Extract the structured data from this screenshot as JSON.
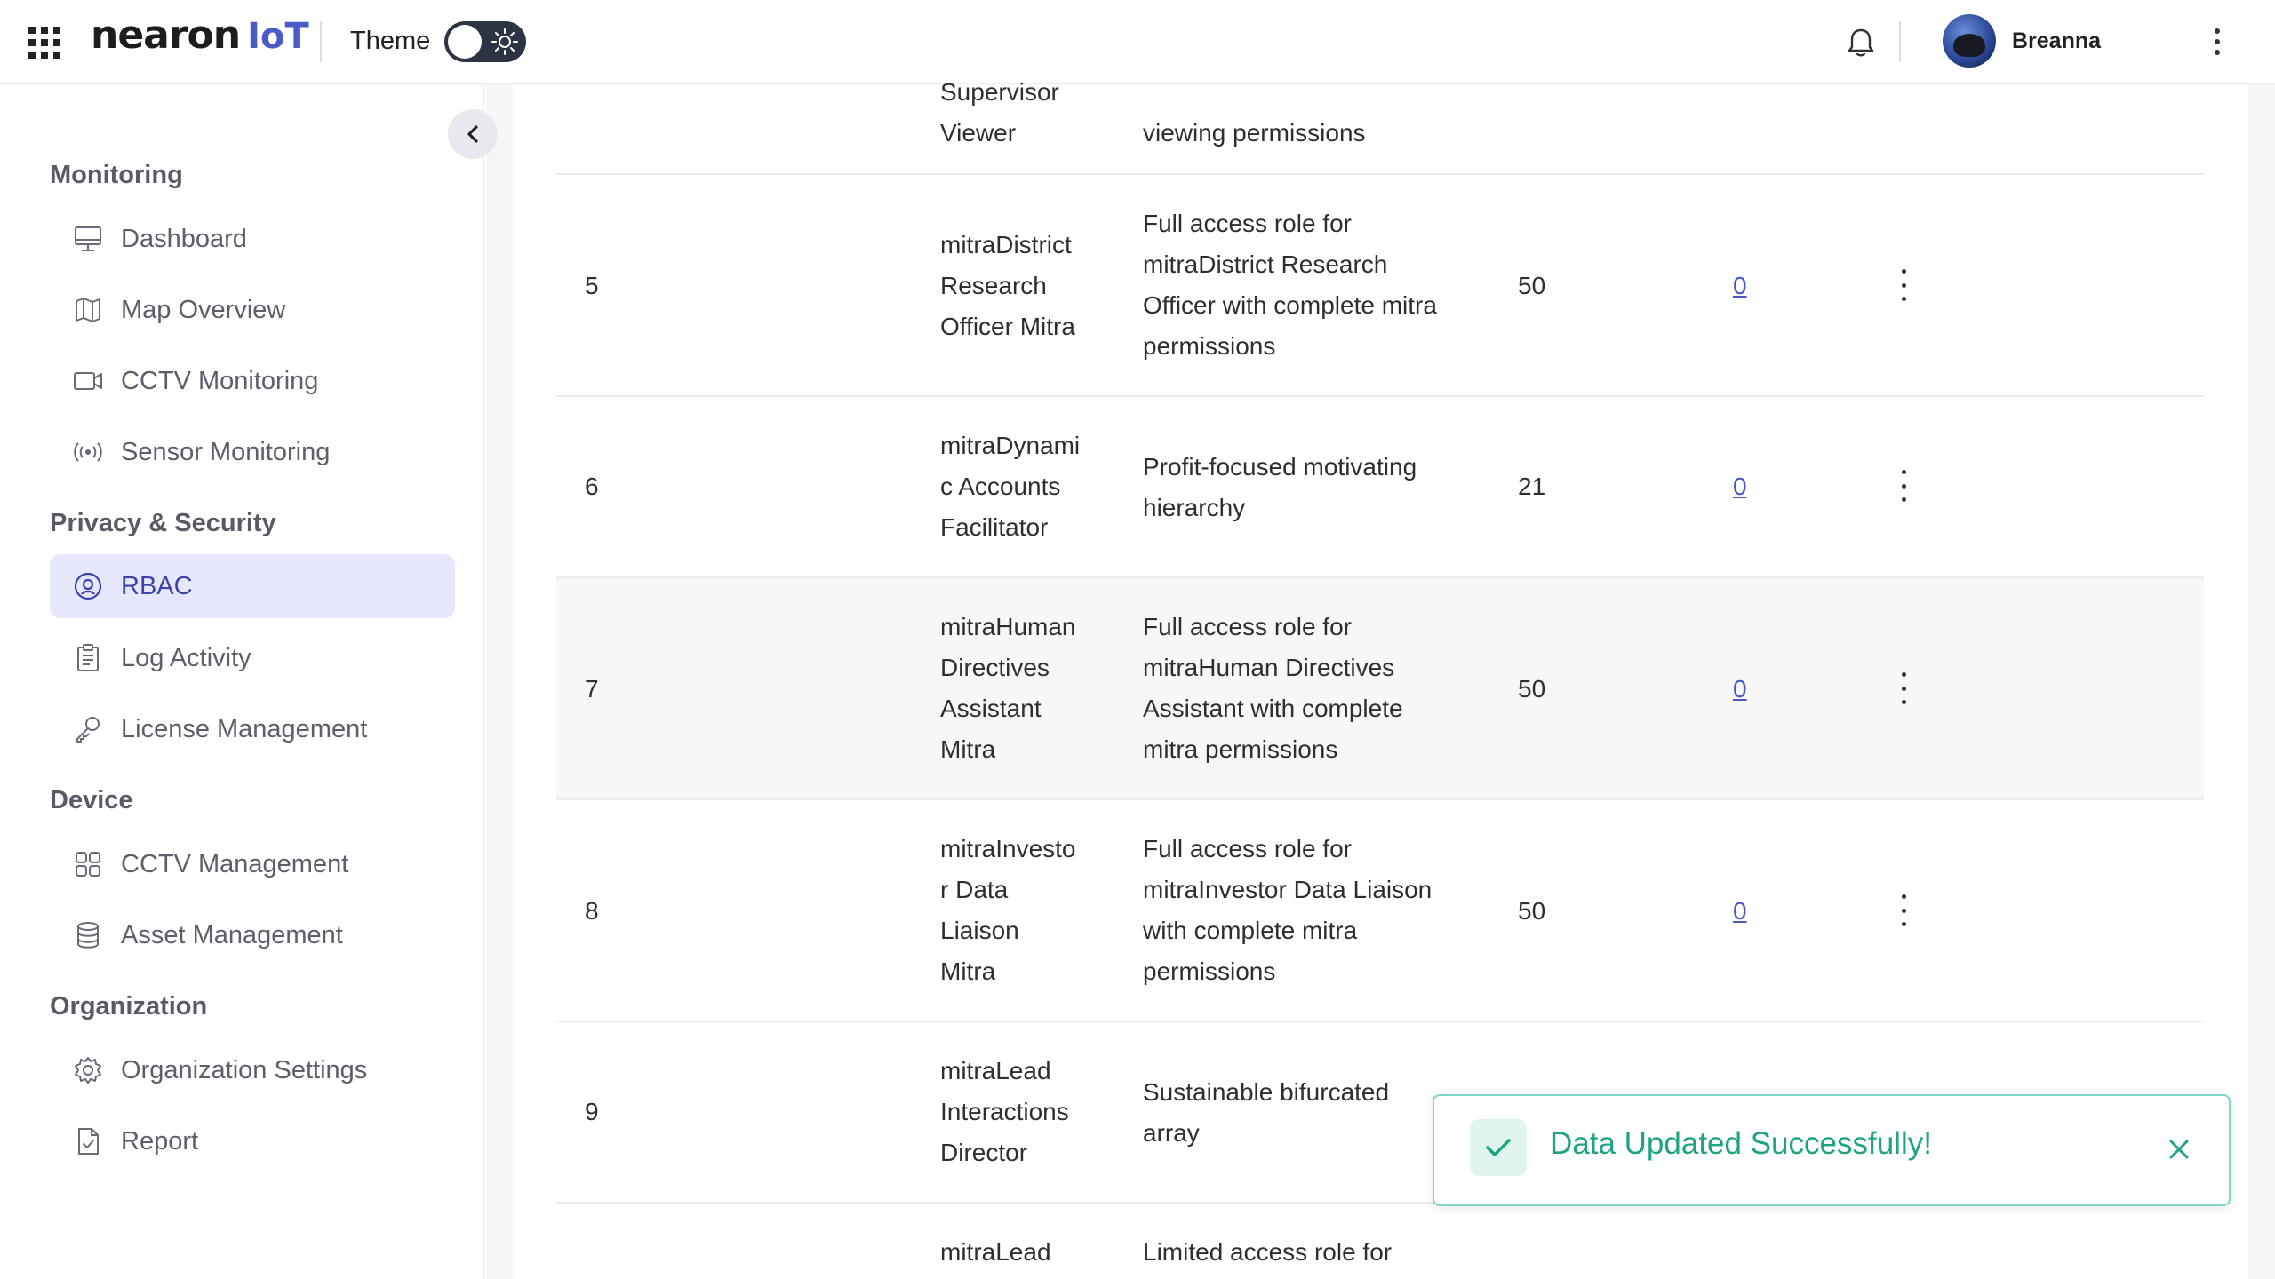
{
  "header": {
    "logo_main": "nearon",
    "logo_suffix": "IoT",
    "theme_label": "Theme",
    "user_name": "Breanna"
  },
  "sidebar": {
    "sections": [
      {
        "title": "Monitoring",
        "items": [
          "Dashboard",
          "Map Overview",
          "CCTV Monitoring",
          "Sensor Monitoring"
        ]
      },
      {
        "title": "Privacy & Security",
        "items": [
          "RBAC",
          "Log Activity",
          "License Management"
        ]
      },
      {
        "title": "Device",
        "items": [
          "CCTV Management",
          "Asset Management"
        ]
      },
      {
        "title": "Organization",
        "items": [
          "Organization Settings",
          "Report"
        ]
      }
    ],
    "active_item": "RBAC"
  },
  "table": {
    "rows": [
      {
        "no": "",
        "name": [
          "Supervisor",
          "Viewer"
        ],
        "desc": [
          "viewing permissions"
        ],
        "num": "",
        "link": ""
      },
      {
        "no": "5",
        "name": [
          "mitraDistrict",
          "Research",
          "Officer Mitra"
        ],
        "desc": [
          "Full access role for",
          "mitraDistrict Research",
          "Officer with complete mitra",
          "permissions"
        ],
        "num": "50",
        "link": "0"
      },
      {
        "no": "6",
        "name": [
          "mitraDynami",
          "c Accounts",
          "Facilitator"
        ],
        "desc": [
          "Profit-focused motivating",
          "hierarchy"
        ],
        "num": "21",
        "link": "0"
      },
      {
        "no": "7",
        "name": [
          "mitraHuman",
          "Directives",
          "Assistant",
          "Mitra"
        ],
        "desc": [
          "Full access role for",
          "mitraHuman Directives",
          "Assistant with complete",
          "mitra permissions"
        ],
        "num": "50",
        "link": "0"
      },
      {
        "no": "8",
        "name": [
          "mitraInvesto",
          "r Data",
          "Liaison",
          "Mitra"
        ],
        "desc": [
          "Full access role for",
          "mitraInvestor Data Liaison",
          "with complete mitra",
          "permissions"
        ],
        "num": "50",
        "link": "0"
      },
      {
        "no": "9",
        "name": [
          "mitraLead",
          "Interactions",
          "Director"
        ],
        "desc": [
          "Sustainable bifurcated",
          "array"
        ],
        "num": "",
        "link": ""
      },
      {
        "no": "",
        "name": [
          "mitraLead"
        ],
        "desc": [
          "Limited access role for"
        ],
        "num": "",
        "link": ""
      }
    ]
  },
  "toast": {
    "message": "Data Updated Successfully!",
    "accent": "#1ea385"
  },
  "colors": {
    "brand": "#4a5ac8",
    "active_bg": "#e6e7fb",
    "active_text": "#3b44a8"
  }
}
